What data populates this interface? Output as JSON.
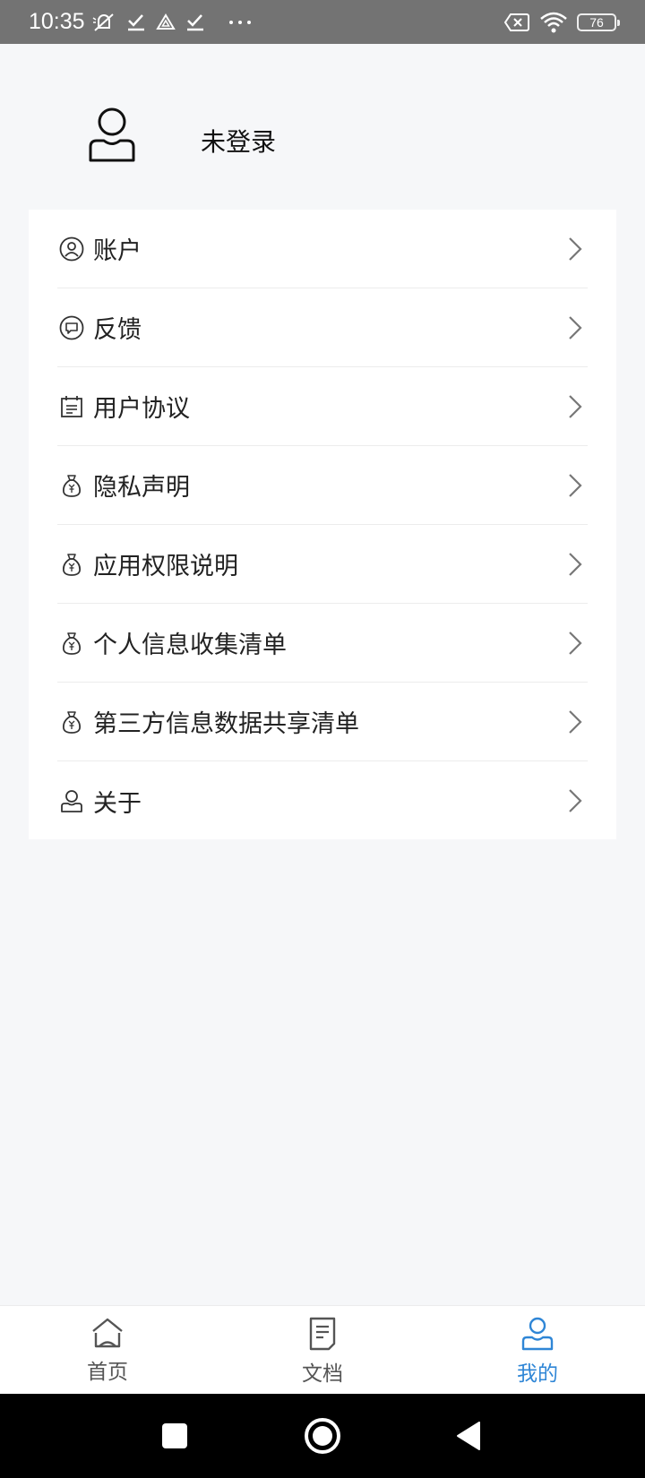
{
  "status_bar": {
    "time": "10:35",
    "battery": "76",
    "icons": [
      "mute-icon",
      "check-icon",
      "drive-icon",
      "check-icon",
      "more-dots-icon",
      "sim-off-icon",
      "wifi-icon",
      "battery-icon"
    ]
  },
  "profile": {
    "login_status": "未登录",
    "avatar_icon": "user-outline-icon"
  },
  "menu": {
    "items": [
      {
        "label": "账户",
        "icon": "account-circle-icon"
      },
      {
        "label": "反馈",
        "icon": "feedback-bubble-icon"
      },
      {
        "label": "用户协议",
        "icon": "calendar-doc-icon"
      },
      {
        "label": "隐私声明",
        "icon": "money-bag-icon"
      },
      {
        "label": "应用权限说明",
        "icon": "money-bag-icon"
      },
      {
        "label": "个人信息收集清单",
        "icon": "money-bag-icon"
      },
      {
        "label": "第三方信息数据共享清单",
        "icon": "money-bag-icon"
      },
      {
        "label": "关于",
        "icon": "person-icon"
      }
    ]
  },
  "tab_bar": {
    "tabs": [
      {
        "label": "首页",
        "icon": "home-icon",
        "active": false
      },
      {
        "label": "文档",
        "icon": "document-icon",
        "active": false
      },
      {
        "label": "我的",
        "icon": "profile-icon",
        "active": true
      }
    ],
    "active_color": "#2f86d6",
    "inactive_color": "#555555"
  },
  "nav_bar": {
    "buttons": [
      "recents-square-icon",
      "home-circle-icon",
      "back-triangle-icon"
    ]
  }
}
